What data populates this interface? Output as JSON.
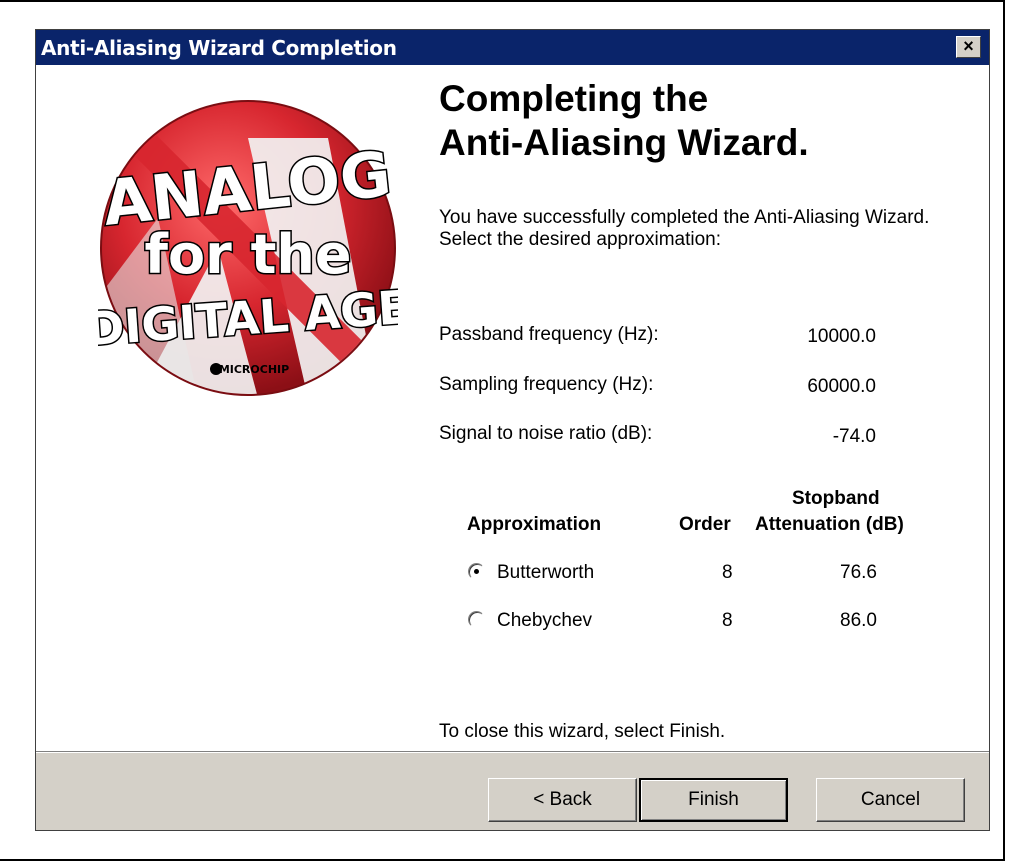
{
  "window": {
    "title": "Anti-Aliasing Wizard Completion",
    "close_label": "×"
  },
  "logo": {
    "line1": "ANALOG",
    "line2": "for the",
    "line3": "DIGITAL AGE",
    "brand": "MICROCHIP"
  },
  "heading": {
    "line1": "Completing the",
    "line2": "Anti-Aliasing Wizard."
  },
  "intro": "You have successfully completed the Anti-Aliasing Wizard.  Select the desired approximation:",
  "fields": [
    {
      "label": "Passband frequency (Hz):",
      "value": "10000.0"
    },
    {
      "label": "Sampling frequency (Hz):",
      "value": "60000.0"
    },
    {
      "label": "Signal to noise ratio (dB):",
      "value": "-74.0"
    }
  ],
  "table": {
    "headers": {
      "approximation": "Approximation",
      "order": "Order",
      "stopband_line1": "Stopband",
      "stopband_line2": "Attenuation (dB)"
    },
    "rows": [
      {
        "name": "Butterworth",
        "order": "8",
        "attenuation": "76.6",
        "selected": true
      },
      {
        "name": "Chebychev",
        "order": "8",
        "attenuation": "86.0",
        "selected": false
      }
    ]
  },
  "closing_text": "To close this wizard, select Finish.",
  "buttons": {
    "back": "< Back",
    "finish": "Finish",
    "cancel": "Cancel"
  },
  "colors": {
    "titlebar": "#0a246a",
    "dialog_face": "#d4d0c8",
    "logo_red": "#d7262f"
  }
}
